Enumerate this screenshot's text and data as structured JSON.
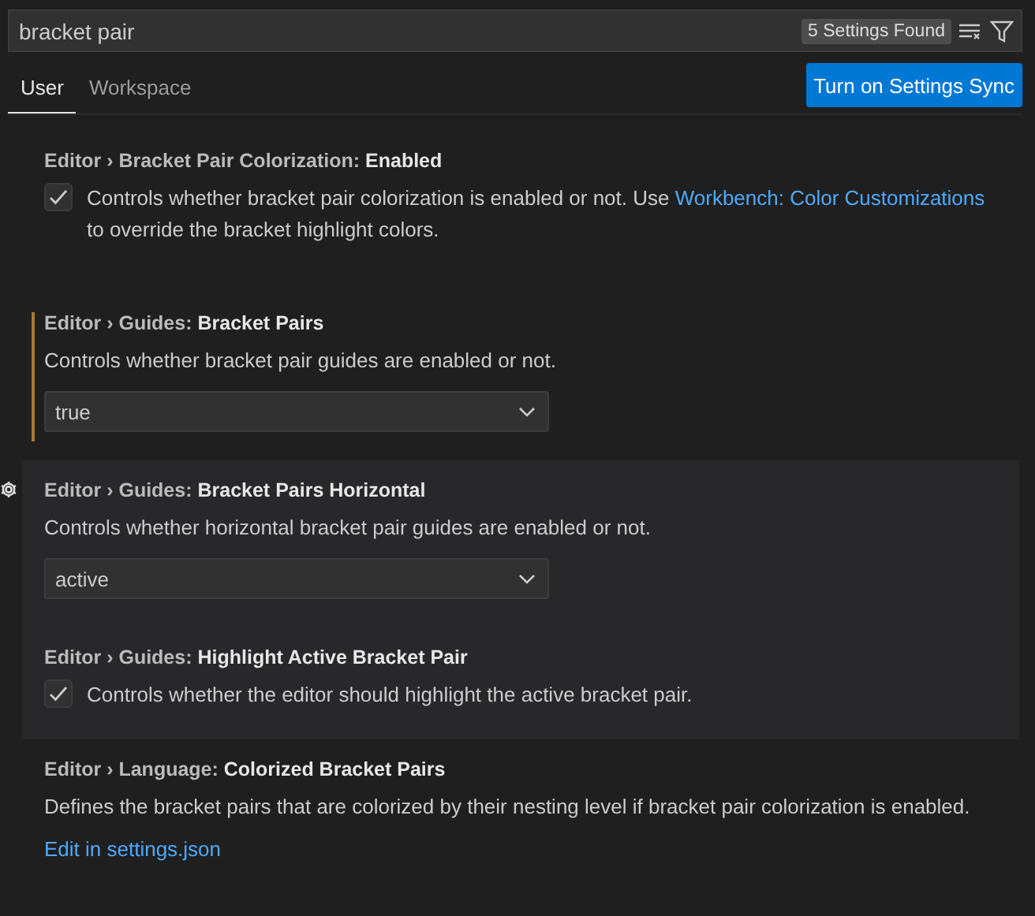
{
  "search": {
    "value": "bracket pair",
    "count": "5 Settings Found"
  },
  "tabs": [
    {
      "label": "User",
      "selected": true
    },
    {
      "label": "Workspace",
      "selected": false
    }
  ],
  "sync_button": "Turn on Settings Sync",
  "settings": [
    {
      "kind": "checkbox",
      "category": "Editor › Bracket Pair Colorization: ",
      "name": "Enabled",
      "checked": true,
      "modified": false,
      "highlighted": false,
      "gear": false,
      "description": "Controls whether bracket pair colorization is enabled or not. Use ",
      "link": "Workbench: Color Customizations",
      "description_end": " to override the bracket highlight colors."
    },
    {
      "kind": "dropdown",
      "category": "Editor › Guides: ",
      "name": "Bracket Pairs",
      "modified": true,
      "highlighted": false,
      "gear": false,
      "description": "Controls whether bracket pair guides are enabled or not.",
      "value": "true"
    },
    {
      "kind": "dropdown",
      "category": "Editor › Guides: ",
      "name": "Bracket Pairs Horizontal",
      "modified": false,
      "highlighted": true,
      "gear": true,
      "description": "Controls whether horizontal bracket pair guides are enabled or not.",
      "value": "active"
    },
    {
      "kind": "checkbox",
      "category": "Editor › Guides: ",
      "name": "Highlight Active Bracket Pair",
      "checked": true,
      "modified": false,
      "highlighted": true,
      "gear": false,
      "description": "Controls whether the editor should highlight the active bracket pair."
    },
    {
      "kind": "json",
      "category": "Editor › Language: ",
      "name": "Colorized Bracket Pairs",
      "modified": false,
      "highlighted": false,
      "gear": false,
      "description": "Defines the bracket pairs that are colorized by their nesting level if bracket pair colorization is enabled.",
      "link": "Edit in settings.json"
    }
  ]
}
